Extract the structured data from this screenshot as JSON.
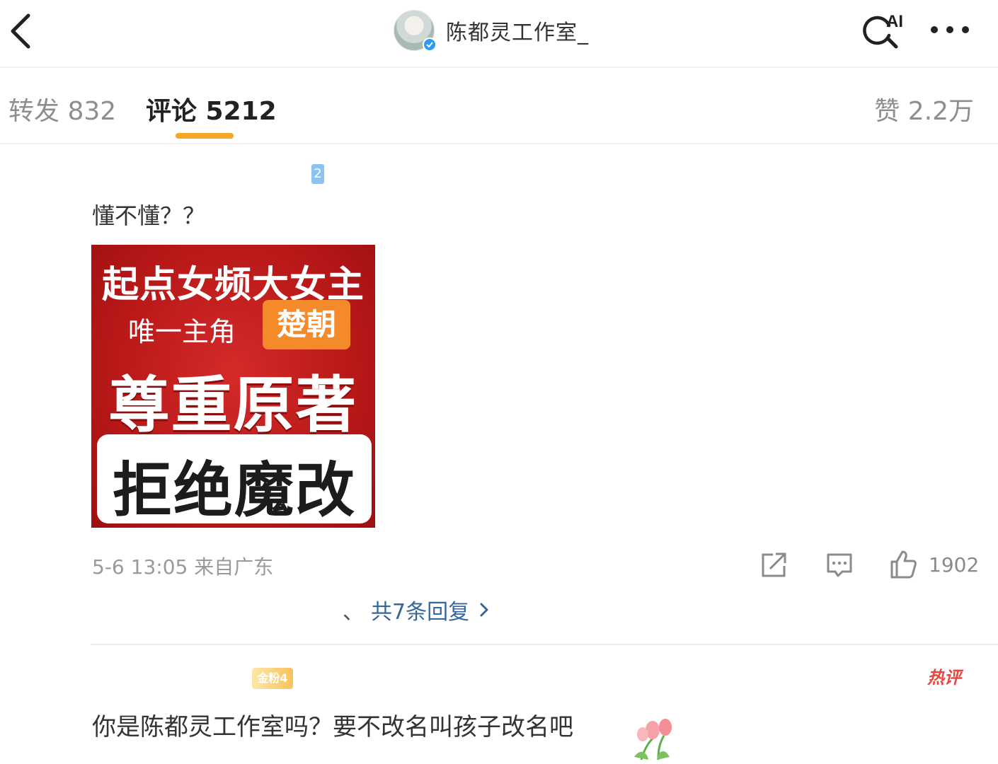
{
  "header": {
    "title": "陈都灵工作室_",
    "ai_label": "AI"
  },
  "tabs": {
    "repost": "转发 832",
    "comment": "评论 5212",
    "like": "赞 2.2万"
  },
  "colors": {
    "tab_accent": "#f6a623",
    "link_blue": "#35679c",
    "verified_blue": "#2f9bf0",
    "poster_red": "#c01f1f",
    "poster_orange": "#f58a2b",
    "hot_red": "#e8473f"
  },
  "comment1": {
    "badge": "2",
    "text": "懂不懂？？",
    "poster": {
      "line1": "起点女频大女主",
      "role": "唯一主角",
      "name": "楚朝",
      "line3": "尊重原著",
      "line4": "拒绝魔改"
    },
    "meta": "5-6 13:05  来自广东",
    "like_count": "1902",
    "replies_sep": "、",
    "replies_label": "共7条回复"
  },
  "comment2": {
    "fan_badge": "金粉4",
    "hot_badge": "热评",
    "text": "你是陈都灵工作室吗？要不改名叫孩子改名吧"
  },
  "icons": [
    "back-arrow-icon",
    "verified-icon",
    "ai-search-icon",
    "more-icon",
    "share-icon",
    "comment-icon",
    "like-icon",
    "chevron-right-icon",
    "tulip-icon"
  ]
}
